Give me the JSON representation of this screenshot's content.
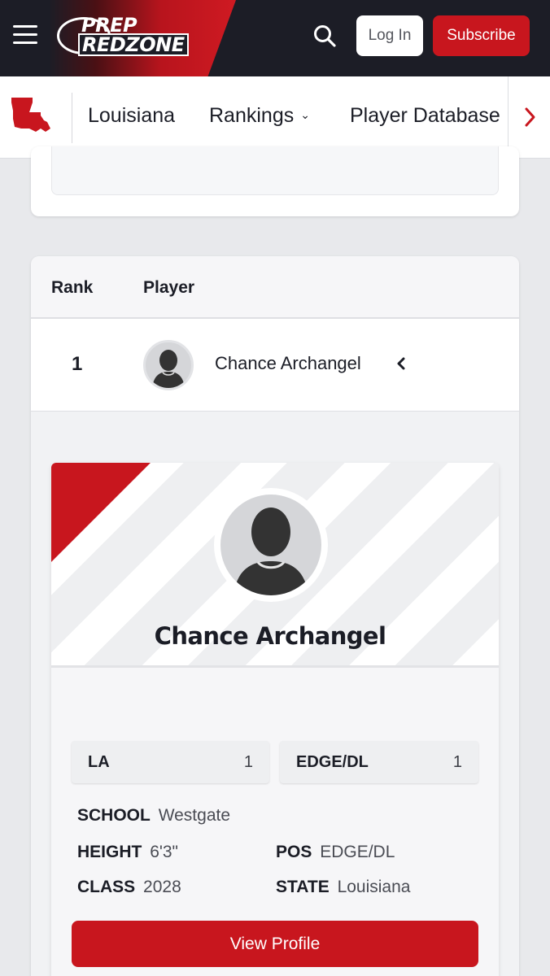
{
  "header": {
    "logo_line1": "PREP",
    "logo_line2": "REDZONE",
    "login_label": "Log In",
    "subscribe_label": "Subscribe",
    "icons": [
      "menu-icon",
      "search-icon"
    ],
    "colors": {
      "dark": "#1c1d26",
      "brand_red": "#c8161e"
    }
  },
  "subnav": {
    "state_icon": "louisiana-state-icon",
    "items": [
      {
        "label": "Louisiana"
      },
      {
        "label": "Rankings",
        "icon": "chevron-down-icon"
      },
      {
        "label": "Player Database"
      }
    ],
    "scroll_icon": "chevron-right-icon"
  },
  "rankings_table": {
    "columns": [
      "Rank",
      "Player"
    ],
    "rows": [
      {
        "rank": "1",
        "player": "Chance Archangel",
        "expand_icon": "chevron-left-icon"
      }
    ]
  },
  "player_card": {
    "name": "Chance Archangel",
    "state_rank_label": "LA",
    "state_rank_value": "1",
    "position_rank_label": "EDGE/DL",
    "position_rank_value": "1",
    "fields": {
      "school_label": "SCHOOL",
      "school_value": "Westgate",
      "height_label": "HEIGHT",
      "height_value": "6'3\"",
      "class_label": "CLASS",
      "class_value": "2028",
      "pos_label": "POS",
      "pos_value": "EDGE/DL",
      "state_label": "STATE",
      "state_value": "Louisiana"
    },
    "view_profile_label": "View Profile"
  }
}
